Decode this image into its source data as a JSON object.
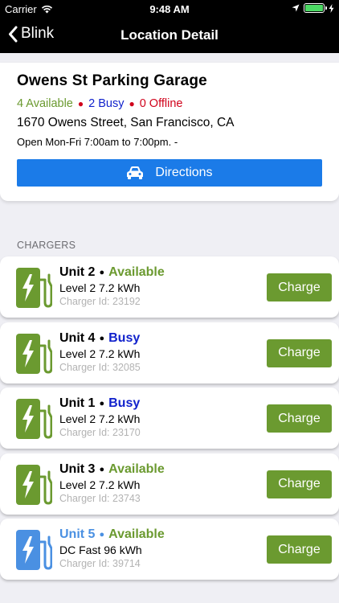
{
  "status_bar": {
    "carrier": "Carrier",
    "time": "9:48 AM"
  },
  "nav": {
    "back_label": "Blink",
    "title": "Location Detail"
  },
  "location": {
    "name": "Owens St Parking Garage",
    "available": "4 Available",
    "busy": "2 Busy",
    "offline": "0 Offline",
    "address": "1670 Owens Street, San Francisco, CA",
    "hours": "Open Mon-Fri 7:00am to 7:00pm.  -",
    "directions_label": "Directions"
  },
  "section_header": "CHARGERS",
  "colors": {
    "available": "#6b9a30",
    "busy": "#1122cc",
    "offline": "#d0021b",
    "level2_icon": "#6b9a30",
    "dcfast_icon": "#4a90e2",
    "directions": "#1b7be8"
  },
  "chargers": [
    {
      "unit": "Unit 2",
      "status": "Available",
      "spec": "Level 2  7.2 kWh",
      "charger_id": "Charger Id: 23192",
      "button": "Charge",
      "icon": "ev-charger-icon",
      "type": "level2"
    },
    {
      "unit": "Unit 4",
      "status": "Busy",
      "spec": "Level 2  7.2 kWh",
      "charger_id": "Charger Id: 32085",
      "button": "Charge",
      "icon": "ev-charger-icon",
      "type": "level2"
    },
    {
      "unit": "Unit 1",
      "status": "Busy",
      "spec": "Level 2  7.2 kWh",
      "charger_id": "Charger Id: 23170",
      "button": "Charge",
      "icon": "ev-charger-icon",
      "type": "level2"
    },
    {
      "unit": "Unit 3",
      "status": "Available",
      "spec": "Level 2  7.2 kWh",
      "charger_id": "Charger Id: 23743",
      "button": "Charge",
      "icon": "ev-charger-icon",
      "type": "level2"
    },
    {
      "unit": "Unit 5",
      "status": "Available",
      "spec": "DC Fast  96 kWh",
      "charger_id": "Charger Id: 39714",
      "button": "Charge",
      "icon": "ev-charger-icon",
      "type": "dcfast"
    }
  ]
}
